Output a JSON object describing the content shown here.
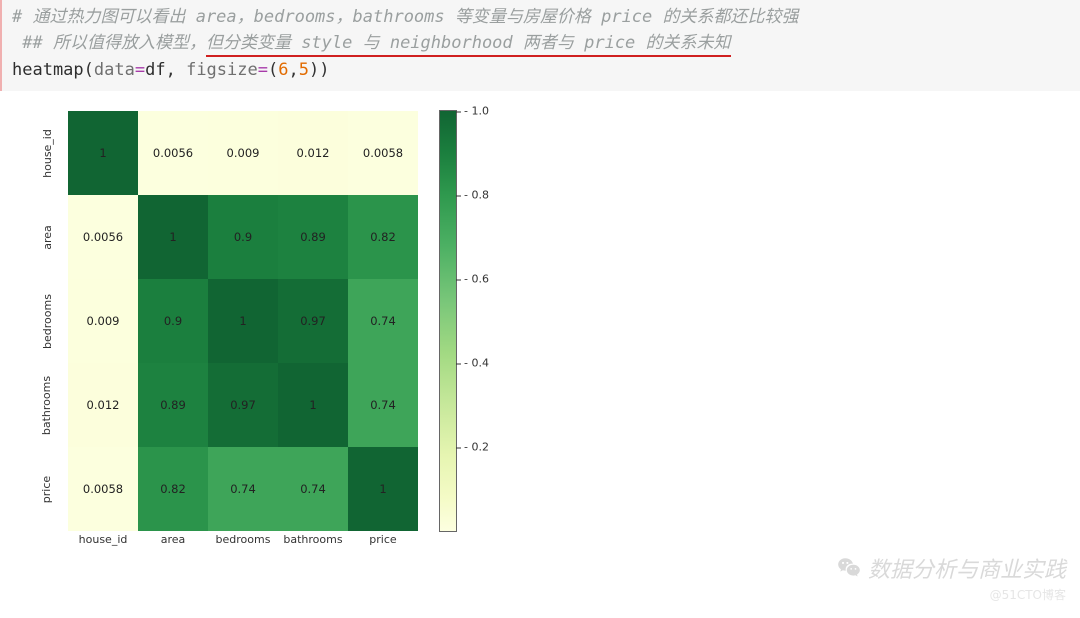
{
  "code": {
    "comment1": "# 通过热力图可以看出 area，bedrooms，bathrooms 等变量与房屋价格 price 的关系都还比较强",
    "comment2_lead": " ## 所以值得放入模型，",
    "comment2_under": "但分类变量 style 与 neighborhood 两者与 price 的关系未知",
    "call_fn": "heatmap",
    "call_open": "(",
    "arg1_name": "data",
    "arg1_eq": "=",
    "arg1_val": "df",
    "sep1": ", ",
    "arg2_name": "figsize",
    "arg2_eq": "=",
    "arg2_open": "(",
    "arg2_a": "6",
    "arg2_comma": ",",
    "arg2_b": "5",
    "arg2_close": ")",
    "call_close": ")"
  },
  "watermark": {
    "main": "数据分析与商业实践",
    "sub": "@51CTO博客"
  },
  "chart_data": {
    "type": "heatmap",
    "title": "",
    "xlabel": "",
    "ylabel": "",
    "categories": [
      "house_id",
      "area",
      "bedrooms",
      "bathrooms",
      "price"
    ],
    "matrix": [
      [
        1,
        0.0056,
        0.009,
        0.012,
        0.0058
      ],
      [
        0.0056,
        1,
        0.9,
        0.89,
        0.82
      ],
      [
        0.009,
        0.9,
        1,
        0.97,
        0.74
      ],
      [
        0.012,
        0.89,
        0.97,
        1,
        0.74
      ],
      [
        0.0058,
        0.82,
        0.74,
        0.74,
        1
      ]
    ],
    "colorbar": {
      "ticks": [
        0.2,
        0.4,
        0.6,
        0.8,
        1.0
      ],
      "range": [
        0,
        1
      ]
    }
  }
}
